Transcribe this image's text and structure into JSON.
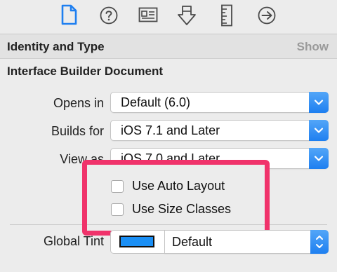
{
  "toolbar": {
    "icons": [
      "file-icon",
      "help-icon",
      "identity-card-icon",
      "attributes-icon",
      "ruler-icon",
      "connections-icon"
    ]
  },
  "section": {
    "title": "Identity and Type",
    "toggle_label": "Show"
  },
  "ib_document": {
    "title": "Interface Builder Document",
    "opens_in": {
      "label": "Opens in",
      "value": "Default (6.0)"
    },
    "builds_for": {
      "label": "Builds for",
      "value": "iOS 7.1 and Later"
    },
    "view_as": {
      "label": "View as",
      "value": "iOS 7.0 and Later"
    },
    "use_auto_layout": {
      "label": "Use Auto Layout",
      "checked": false
    },
    "use_size_classes": {
      "label": "Use Size Classes",
      "checked": false
    },
    "global_tint": {
      "label": "Global Tint",
      "value": "Default",
      "color": "#1a8ff5"
    }
  },
  "colors": {
    "highlight": "#f0336b",
    "accent": "#1e7ff0",
    "selected_icon": "#1e7ff0",
    "icon": "#4a4a4a"
  }
}
